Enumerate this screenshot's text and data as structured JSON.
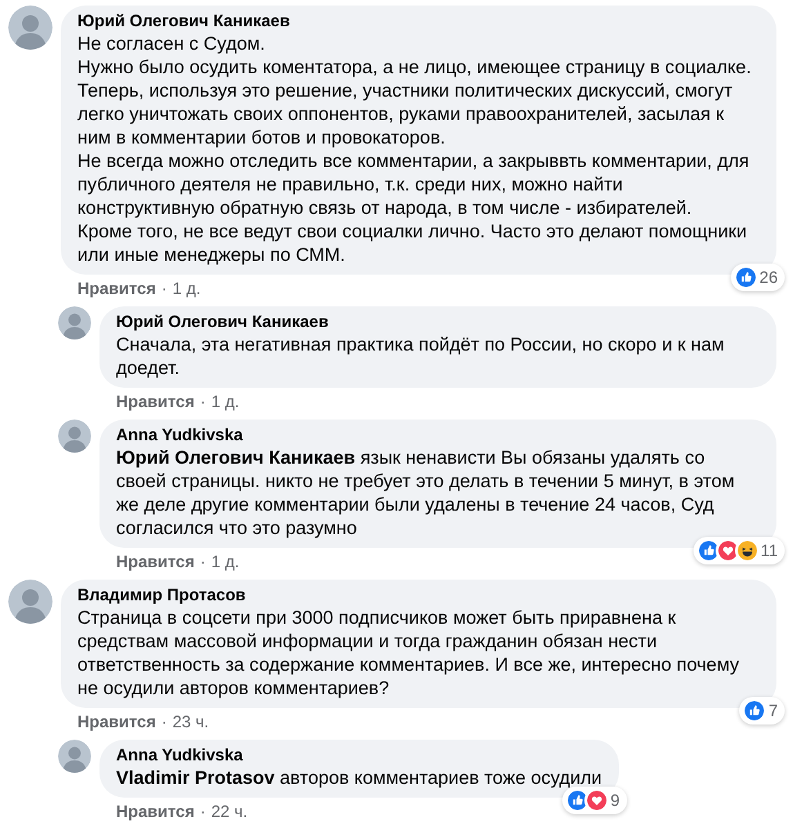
{
  "comments": [
    {
      "author": "Юрий Олегович Каникаев",
      "text": "Не согласен с Судом.\nНужно было осудить коментатора, а не лицо, имеющее страницу в социалке.\nТеперь, используя это решение, участники политических дискуссий, смогут легко уничтожать своих оппонентов, руками правоохранителей, засылая к ним в комментарии ботов и провокаторов.\nНе всегда можно отследить все комментарии, а закрыввть комментарии, для публичного деятеля не правильно, т.к. среди них, можно найти конструктивную обратную связь от народа, в том числе - избирателей.\nКроме того, не все ведут свои социалки лично. Часто это делают помощники или иные менеджеры по СММ.",
      "like": "Нравится",
      "dot": "·",
      "time": "1 д.",
      "reactions": [
        {
          "kind": "like"
        }
      ],
      "reaction_count": "26",
      "children": [
        {
          "author": "Юрий Олегович Каникаев",
          "text": "Сначала, эта негативная практика пойдёт по России, но скоро и к нам доедет.",
          "like": "Нравится",
          "dot": "·",
          "time": "1 д."
        },
        {
          "author": "Anna Yudkivska",
          "text": "**Юрий Олегович Каникаев** язык ненависти Вы обязаны удалять со своей страницы. никто не требует это делать в течении 5 минут, в этом же деле другие комментарии были удалены в течение 24 часов, Суд согласился что это разумно",
          "like": "Нравится",
          "dot": "·",
          "time": "1 д.",
          "reactions": [
            {
              "kind": "like"
            },
            {
              "kind": "love"
            },
            {
              "kind": "haha"
            }
          ],
          "reaction_count": "11"
        }
      ]
    },
    {
      "author": "Владимир Протасов",
      "text": "Страница в соцсети при 3000 подписчиков может быть приравнена к средствам массовой информации и тогда гражданин обязан нести ответственность за содержание комментариев. И все же, интересно почему не осудили авторов комментариев?",
      "like": "Нравится",
      "dot": "·",
      "time": "23 ч.",
      "reactions": [
        {
          "kind": "like"
        }
      ],
      "reaction_count": "7",
      "children": [
        {
          "author": "Anna Yudkivska",
          "text": "**Vladimir Protasov** авторов комментариев тоже осудили",
          "like": "Нравится",
          "dot": "·",
          "time": "22 ч.",
          "reactions": [
            {
              "kind": "like"
            },
            {
              "kind": "love"
            }
          ],
          "reaction_count": "9"
        }
      ]
    }
  ]
}
